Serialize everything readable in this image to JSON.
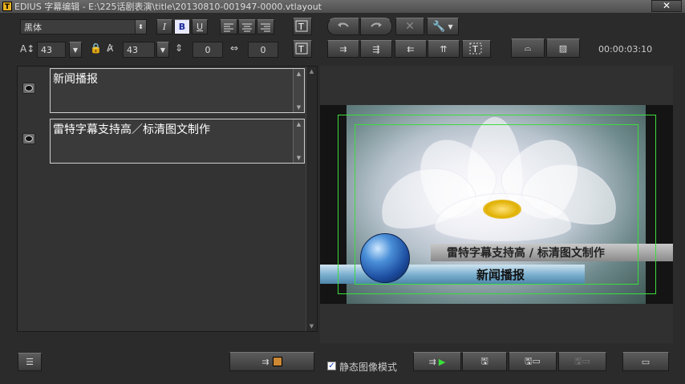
{
  "window": {
    "title": "EDIUS 字幕编辑 - E:\\225话剧表演\\title\\20130810-001947-0000.vtlayout",
    "close_label": "✕",
    "app_icon": "T"
  },
  "toolbar": {
    "font_name": "黑体",
    "italic_label": "I",
    "bold_label": "B",
    "underline_label": "U",
    "font_size": "43",
    "font_size_linked": "43",
    "line_spacing": "0",
    "char_spacing": "0",
    "timecode": "00:00:03:10"
  },
  "text_rows": [
    {
      "text": "新闻播报"
    },
    {
      "text": "雷特字幕支持高／标清图文制作"
    }
  ],
  "preview": {
    "top_bar_text": "雷特字幕支持高 / 标清图文制作",
    "bottom_bar_text": "新闻播报"
  },
  "bottom": {
    "still_mode_label": "静态图像模式",
    "still_mode_checked": "✓"
  },
  "colors": {
    "safe_area": "#3cdc3c",
    "background": "#2b2b2b"
  }
}
